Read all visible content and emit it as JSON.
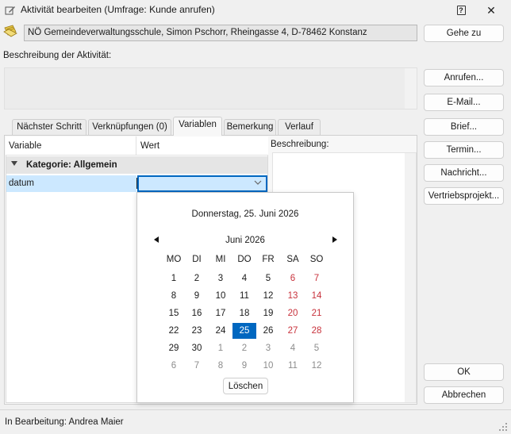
{
  "window": {
    "title": "Aktivität bearbeiten (Umfrage: Kunde anrufen)",
    "help_label": "?",
    "close_label": "✕"
  },
  "address": {
    "value": "NÖ Gemeindeverwaltungsschule, Simon Pschorr, Rheingasse 4, D-78462 Konstanz",
    "goto_label": "Gehe zu"
  },
  "description": {
    "label": "Beschreibung der Aktivität:"
  },
  "side_buttons": {
    "anrufen": "Anrufen...",
    "email": "E-Mail...",
    "brief": "Brief...",
    "termin": "Termin...",
    "nachricht": "Nachricht...",
    "vertrieb": "Vertriebsprojekt..."
  },
  "tabs": [
    {
      "label": "Nächster Schritt"
    },
    {
      "label": "Verknüpfungen (0)"
    },
    {
      "label": "Variablen"
    },
    {
      "label": "Bemerkung"
    },
    {
      "label": "Verlauf"
    }
  ],
  "grid": {
    "col_variable": "Variable",
    "col_wert": "Wert",
    "category": "Kategorie: Allgemein",
    "row_label": "datum",
    "beschreibung_label": "Beschreibung:"
  },
  "calendar": {
    "full_date": "Donnerstag, 25. Juni 2026",
    "month_label": "Juni 2026",
    "weekdays": [
      "MO",
      "DI",
      "MI",
      "DO",
      "FR",
      "SA",
      "SO"
    ],
    "weeks": [
      [
        {
          "d": "1",
          "m": "cur"
        },
        {
          "d": "2",
          "m": "cur"
        },
        {
          "d": "3",
          "m": "cur"
        },
        {
          "d": "4",
          "m": "cur"
        },
        {
          "d": "5",
          "m": "cur"
        },
        {
          "d": "6",
          "m": "cur"
        },
        {
          "d": "7",
          "m": "cur"
        }
      ],
      [
        {
          "d": "8",
          "m": "cur"
        },
        {
          "d": "9",
          "m": "cur"
        },
        {
          "d": "10",
          "m": "cur"
        },
        {
          "d": "11",
          "m": "cur"
        },
        {
          "d": "12",
          "m": "cur"
        },
        {
          "d": "13",
          "m": "cur"
        },
        {
          "d": "14",
          "m": "cur"
        }
      ],
      [
        {
          "d": "15",
          "m": "cur"
        },
        {
          "d": "16",
          "m": "cur"
        },
        {
          "d": "17",
          "m": "cur"
        },
        {
          "d": "18",
          "m": "cur"
        },
        {
          "d": "19",
          "m": "cur"
        },
        {
          "d": "20",
          "m": "cur"
        },
        {
          "d": "21",
          "m": "cur"
        }
      ],
      [
        {
          "d": "22",
          "m": "cur"
        },
        {
          "d": "23",
          "m": "cur"
        },
        {
          "d": "24",
          "m": "cur"
        },
        {
          "d": "25",
          "m": "cur",
          "selected": true
        },
        {
          "d": "26",
          "m": "cur"
        },
        {
          "d": "27",
          "m": "cur"
        },
        {
          "d": "28",
          "m": "cur"
        }
      ],
      [
        {
          "d": "29",
          "m": "cur"
        },
        {
          "d": "30",
          "m": "cur"
        },
        {
          "d": "1",
          "m": "next"
        },
        {
          "d": "2",
          "m": "next"
        },
        {
          "d": "3",
          "m": "next"
        },
        {
          "d": "4",
          "m": "next"
        },
        {
          "d": "5",
          "m": "next"
        }
      ],
      [
        {
          "d": "6",
          "m": "next"
        },
        {
          "d": "7",
          "m": "next"
        },
        {
          "d": "8",
          "m": "next"
        },
        {
          "d": "9",
          "m": "next"
        },
        {
          "d": "10",
          "m": "next"
        },
        {
          "d": "11",
          "m": "next"
        },
        {
          "d": "12",
          "m": "next"
        }
      ]
    ],
    "clear_label": "Löschen",
    "colors": {
      "accent": "#0067c0",
      "weekend": "#c8323c",
      "other_month": "#8c8c8c"
    }
  },
  "footer": {
    "ok_label": "OK",
    "cancel_label": "Abbrechen",
    "status": "In Bearbeitung: Andrea Maier"
  },
  "icons": {
    "title": "edit-pencil-icon",
    "address": "contact-card-icon",
    "prev": "triangle-left-icon",
    "next": "triangle-right-icon",
    "dropdown": "chevron-down-icon",
    "collapse": "caret-down-icon",
    "grip": "resize-grip-icon"
  }
}
